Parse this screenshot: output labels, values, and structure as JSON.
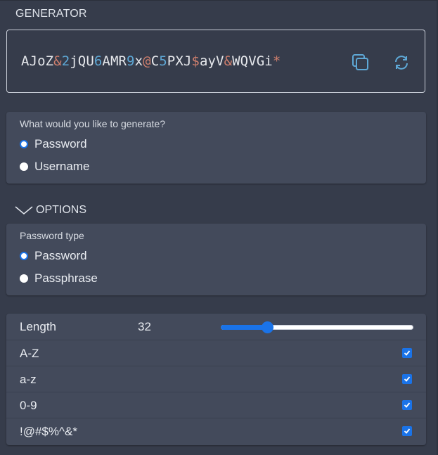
{
  "generator": {
    "title": "GENERATOR",
    "password_segments": [
      {
        "t": "AJoZ",
        "k": "letter"
      },
      {
        "t": "&",
        "k": "special"
      },
      {
        "t": "2",
        "k": "digit"
      },
      {
        "t": "jQU",
        "k": "letter"
      },
      {
        "t": "6",
        "k": "digit"
      },
      {
        "t": "AMR",
        "k": "letter"
      },
      {
        "t": "9",
        "k": "digit"
      },
      {
        "t": "x",
        "k": "letter"
      },
      {
        "t": "@",
        "k": "special"
      },
      {
        "t": "C",
        "k": "letter"
      },
      {
        "t": "5",
        "k": "digit"
      },
      {
        "t": "PXJ",
        "k": "letter"
      },
      {
        "t": "$",
        "k": "special"
      },
      {
        "t": "ayV",
        "k": "letter"
      },
      {
        "t": "&",
        "k": "special"
      },
      {
        "t": "WQVGi",
        "k": "letter"
      },
      {
        "t": "*",
        "k": "special"
      }
    ],
    "copy_icon": "copy-icon",
    "regenerate_icon": "refresh-icon"
  },
  "generate_type": {
    "question": "What would you like to generate?",
    "options": [
      {
        "label": "Password",
        "checked": true
      },
      {
        "label": "Username",
        "checked": false
      }
    ]
  },
  "options": {
    "header": "OPTIONS",
    "icon": "chevron-down-icon",
    "password_type": {
      "label": "Password type",
      "options": [
        {
          "label": "Password",
          "checked": true
        },
        {
          "label": "Passphrase",
          "checked": false
        }
      ]
    },
    "settings": {
      "length_label": "Length",
      "length_value": "32",
      "slider_fraction": 0.24,
      "charsets": [
        {
          "label": "A-Z",
          "checked": true
        },
        {
          "label": "a-z",
          "checked": true
        },
        {
          "label": "0-9",
          "checked": true
        },
        {
          "label": "!@#$%^&*",
          "checked": true
        }
      ]
    }
  },
  "colors": {
    "accent": "#1a73e8",
    "digit": "#5ea8d6",
    "special": "#cf7f6d",
    "background": "#363c4b",
    "card": "#434a5b"
  }
}
